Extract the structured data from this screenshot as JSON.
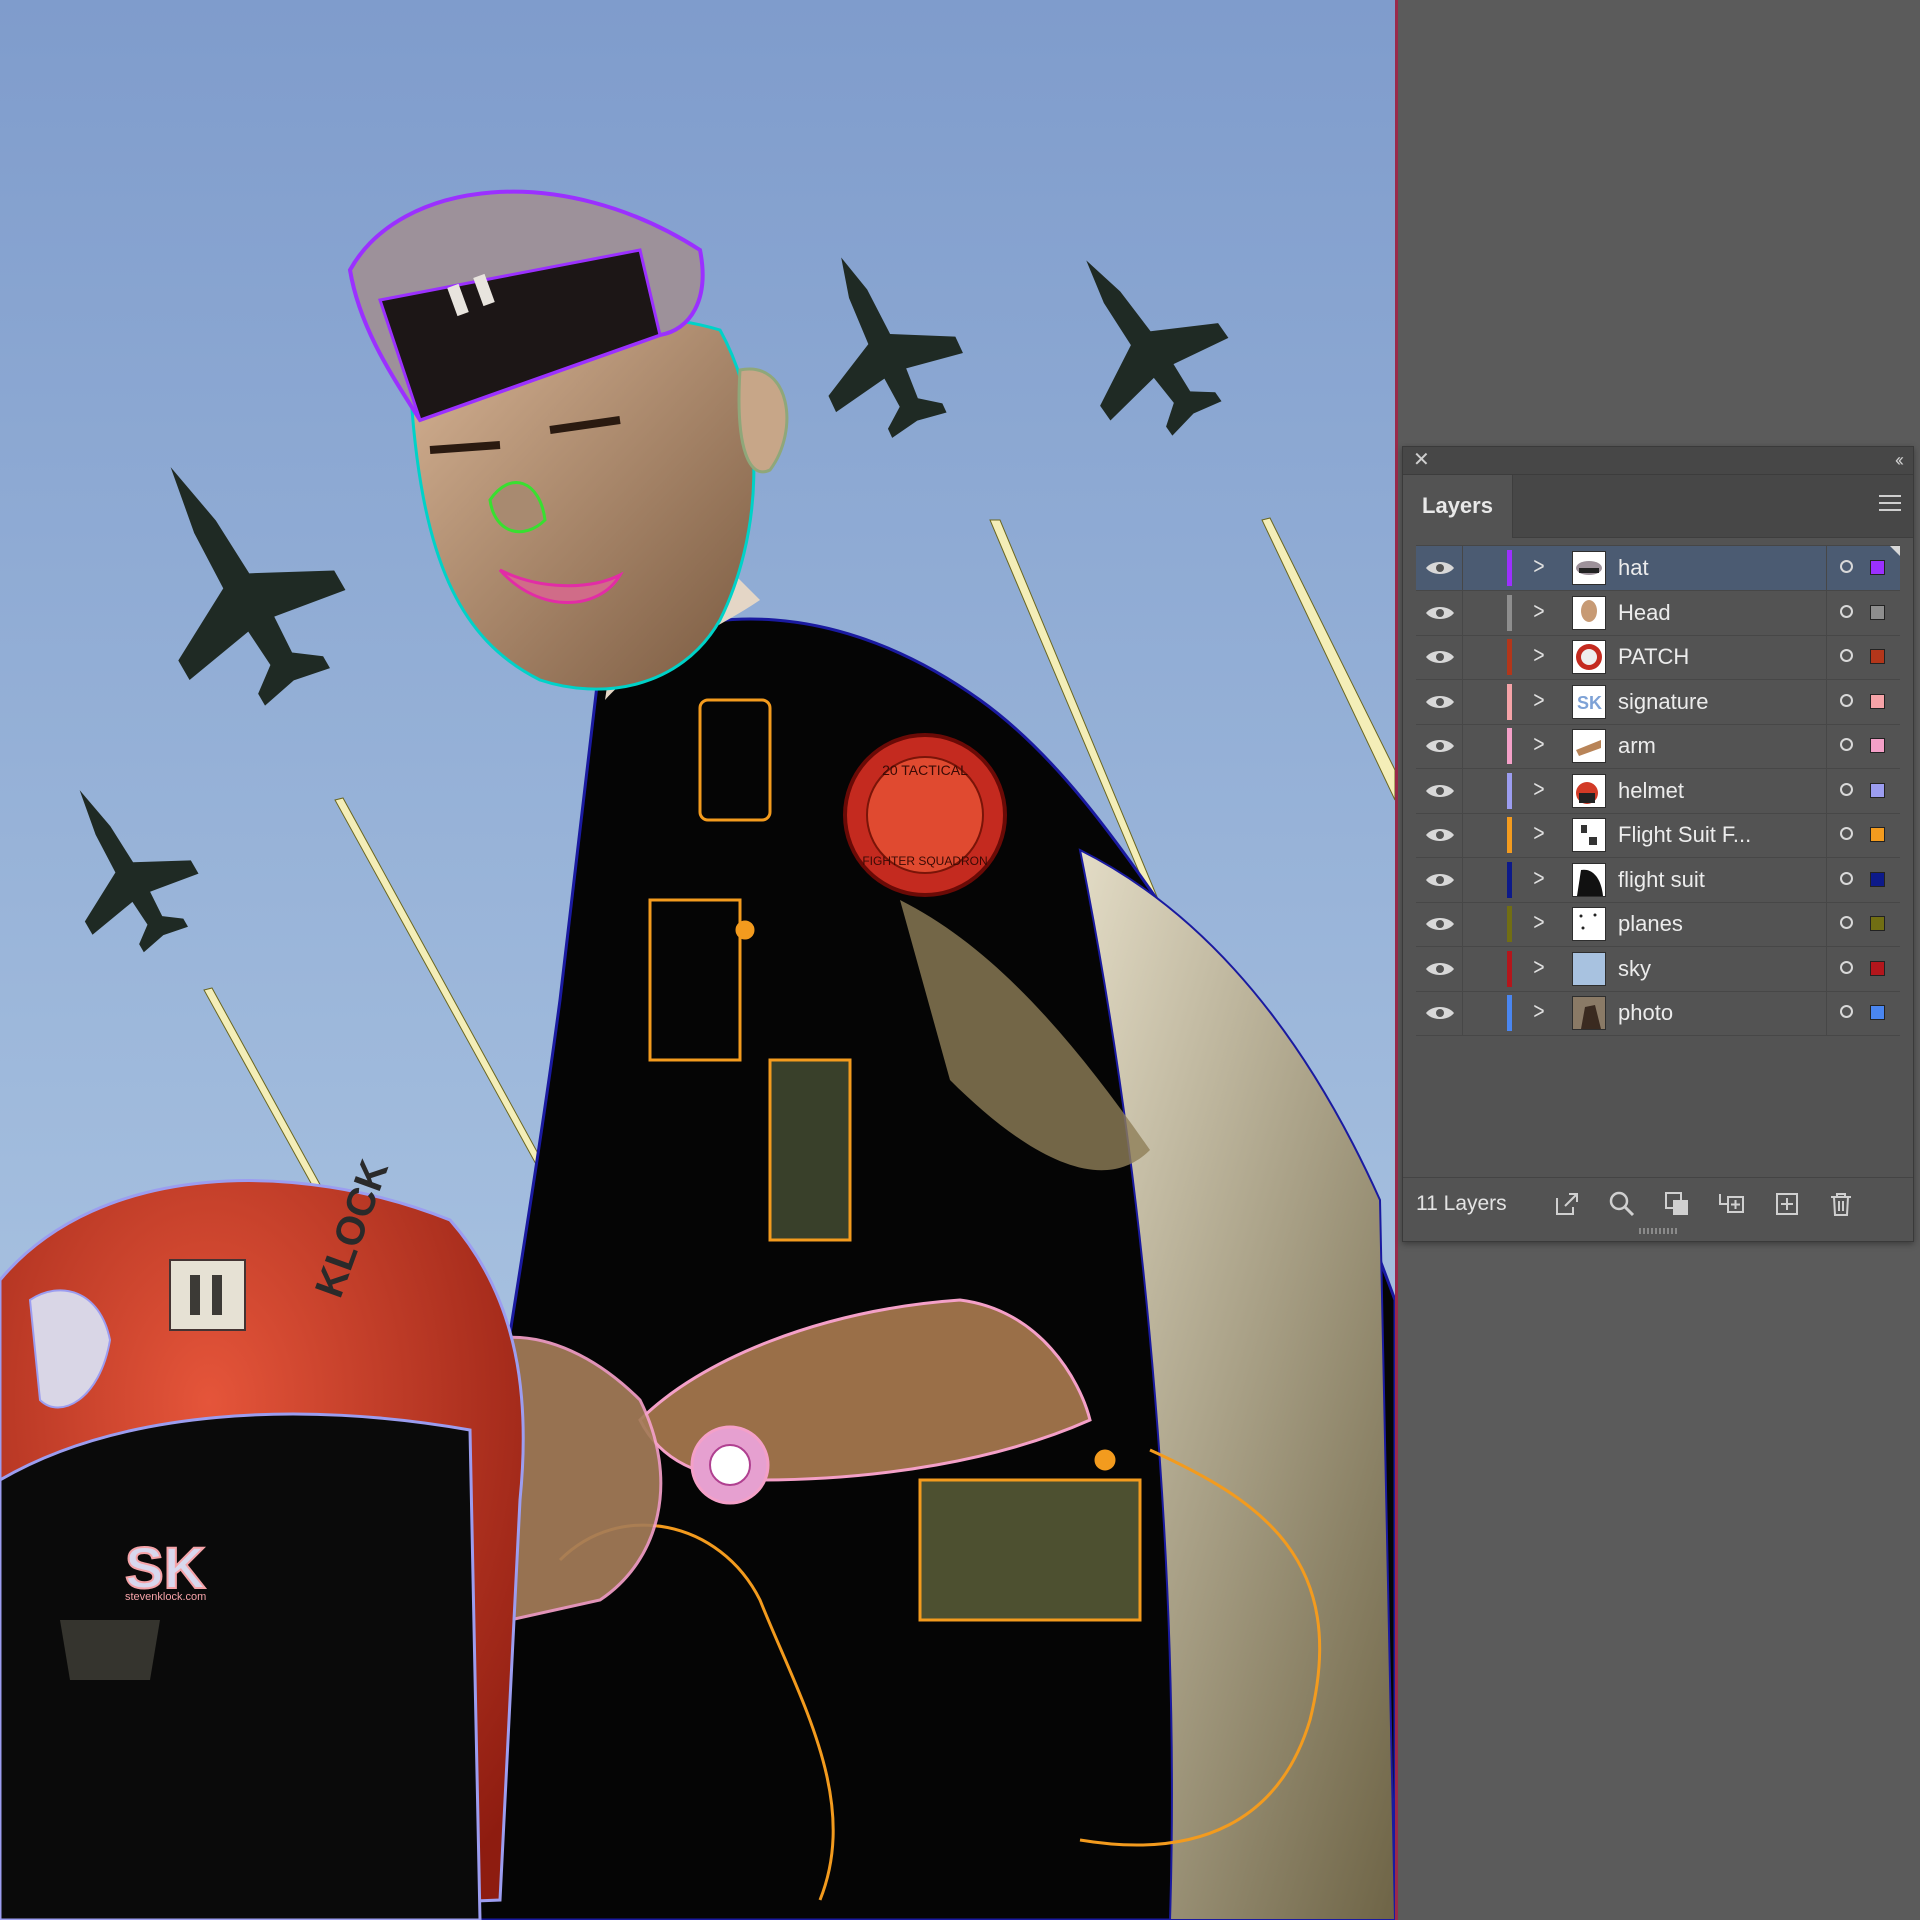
{
  "panel": {
    "tab_label": "Layers",
    "layer_count_label": "11 Layers",
    "close_glyph": "✕",
    "collapse_glyph": "‹‹",
    "layers": [
      {
        "name": "hat",
        "color": "#9b30ff",
        "selected": true
      },
      {
        "name": "Head",
        "color": "#8e8e8e",
        "selected": false
      },
      {
        "name": "PATCH",
        "color": "#b3361a",
        "selected": false
      },
      {
        "name": "signature",
        "color": "#f6a3a8",
        "selected": false
      },
      {
        "name": "arm",
        "color": "#f4a0c8",
        "selected": false
      },
      {
        "name": "helmet",
        "color": "#9c9df0",
        "selected": false
      },
      {
        "name": "Flight Suit F...",
        "color": "#f39b1e",
        "selected": false
      },
      {
        "name": "flight suit",
        "color": "#0d1a8a",
        "selected": false
      },
      {
        "name": "planes",
        "color": "#716e13",
        "selected": false
      },
      {
        "name": "sky",
        "color": "#b4161c",
        "selected": false
      },
      {
        "name": "photo",
        "color": "#4a86f0",
        "selected": false
      }
    ],
    "footer_icons": [
      "export-icon",
      "search-icon",
      "clipping-mask-icon",
      "new-sublayer-icon",
      "new-layer-icon",
      "trash-icon"
    ]
  },
  "artwork": {
    "helmet_name": "KLOCK",
    "signature_logo": "SK",
    "signature_url": "stevenklock.com",
    "patch_text_top": "20 TACTICAL",
    "patch_text_bottom": "FIGHTER SQUADRON",
    "colors": {
      "sky_top": "#7f9ccc",
      "sky_bottom": "#b7d0e8",
      "plane": "#1f2a24",
      "suit": "#050505",
      "helmet_red": "#d23a26"
    }
  }
}
